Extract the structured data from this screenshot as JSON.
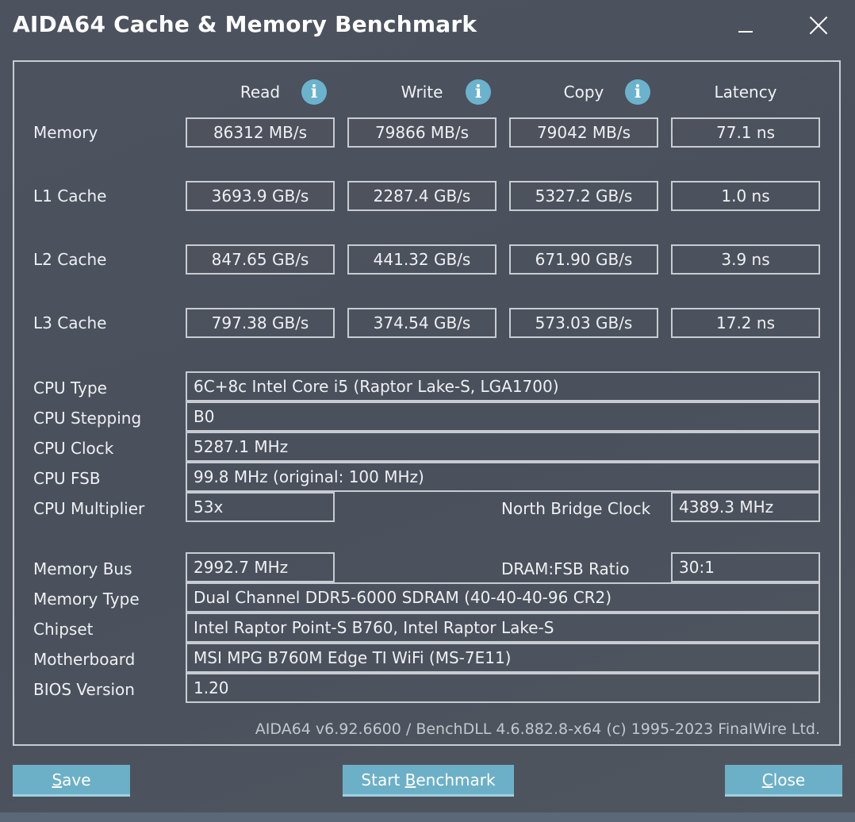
{
  "window": {
    "title": "AIDA64 Cache & Memory Benchmark",
    "minimize_icon": "minimize-icon",
    "close_icon": "close-icon"
  },
  "columns": {
    "read": "Read",
    "write": "Write",
    "copy": "Copy",
    "latency": "Latency",
    "info_glyph": "i"
  },
  "benchmarks": {
    "memory": {
      "label": "Memory",
      "read": "86312 MB/s",
      "write": "79866 MB/s",
      "copy": "79042 MB/s",
      "latency": "77.1 ns"
    },
    "l1": {
      "label": "L1 Cache",
      "read": "3693.9 GB/s",
      "write": "2287.4 GB/s",
      "copy": "5327.2 GB/s",
      "latency": "1.0 ns"
    },
    "l2": {
      "label": "L2 Cache",
      "read": "847.65 GB/s",
      "write": "441.32 GB/s",
      "copy": "671.90 GB/s",
      "latency": "3.9 ns"
    },
    "l3": {
      "label": "L3 Cache",
      "read": "797.38 GB/s",
      "write": "374.54 GB/s",
      "copy": "573.03 GB/s",
      "latency": "17.2 ns"
    }
  },
  "cpu": {
    "type_label": "CPU Type",
    "type": "6C+8c Intel Core i5  (Raptor Lake-S, LGA1700)",
    "stepping_label": "CPU Stepping",
    "stepping": "B0",
    "clock_label": "CPU Clock",
    "clock": "5287.1 MHz",
    "fsb_label": "CPU FSB",
    "fsb": "99.8 MHz  (original: 100 MHz)",
    "multiplier_label": "CPU Multiplier",
    "multiplier": "53x",
    "nb_clock_label": "North Bridge Clock",
    "nb_clock": "4389.3 MHz"
  },
  "memory_info": {
    "bus_label": "Memory Bus",
    "bus": "2992.7 MHz",
    "ratio_label": "DRAM:FSB Ratio",
    "ratio": "30:1",
    "type_label": "Memory Type",
    "type": "Dual Channel DDR5-6000 SDRAM  (40-40-40-96 CR2)",
    "chipset_label": "Chipset",
    "chipset": "Intel Raptor Point-S B760, Intel Raptor Lake-S",
    "motherboard_label": "Motherboard",
    "motherboard": "MSI MPG B760M Edge TI WiFi (MS-7E11)",
    "bios_label": "BIOS Version",
    "bios": "1.20"
  },
  "footer": {
    "version": "AIDA64 v6.92.6600 / BenchDLL 4.6.882.8-x64  (c) 1995-2023 FinalWire Ltd."
  },
  "buttons": {
    "save_accel": "S",
    "save_rest": "ave",
    "start_pre": "Start ",
    "start_accel": "B",
    "start_rest": "enchmark",
    "close_accel": "C",
    "close_rest": "lose"
  },
  "colors": {
    "background": "#4a505c",
    "accent": "#6cb0c8",
    "border": "#c8ccd2"
  }
}
